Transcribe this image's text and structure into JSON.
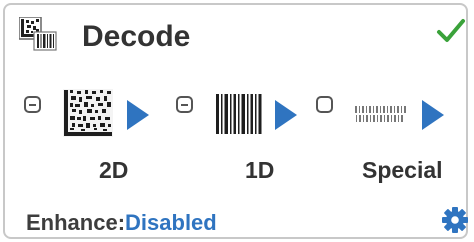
{
  "panel": {
    "title": "Decode",
    "status_icon": "checkmark-icon",
    "header_icon": "decode-icon"
  },
  "symbologies": [
    {
      "label": "2D",
      "state": "indeterminate",
      "icon": "datamatrix-icon"
    },
    {
      "label": "1D",
      "state": "indeterminate",
      "icon": "barcode-icon"
    },
    {
      "label": "Special",
      "state": "unchecked",
      "icon": "special-code-icon"
    }
  ],
  "enhance": {
    "label": "Enhance:",
    "value": "Disabled"
  },
  "settings_icon": "gear-icon",
  "colors": {
    "accent_blue": "#2f74c0",
    "check_green": "#3aa23a",
    "text_dark": "#333333"
  }
}
